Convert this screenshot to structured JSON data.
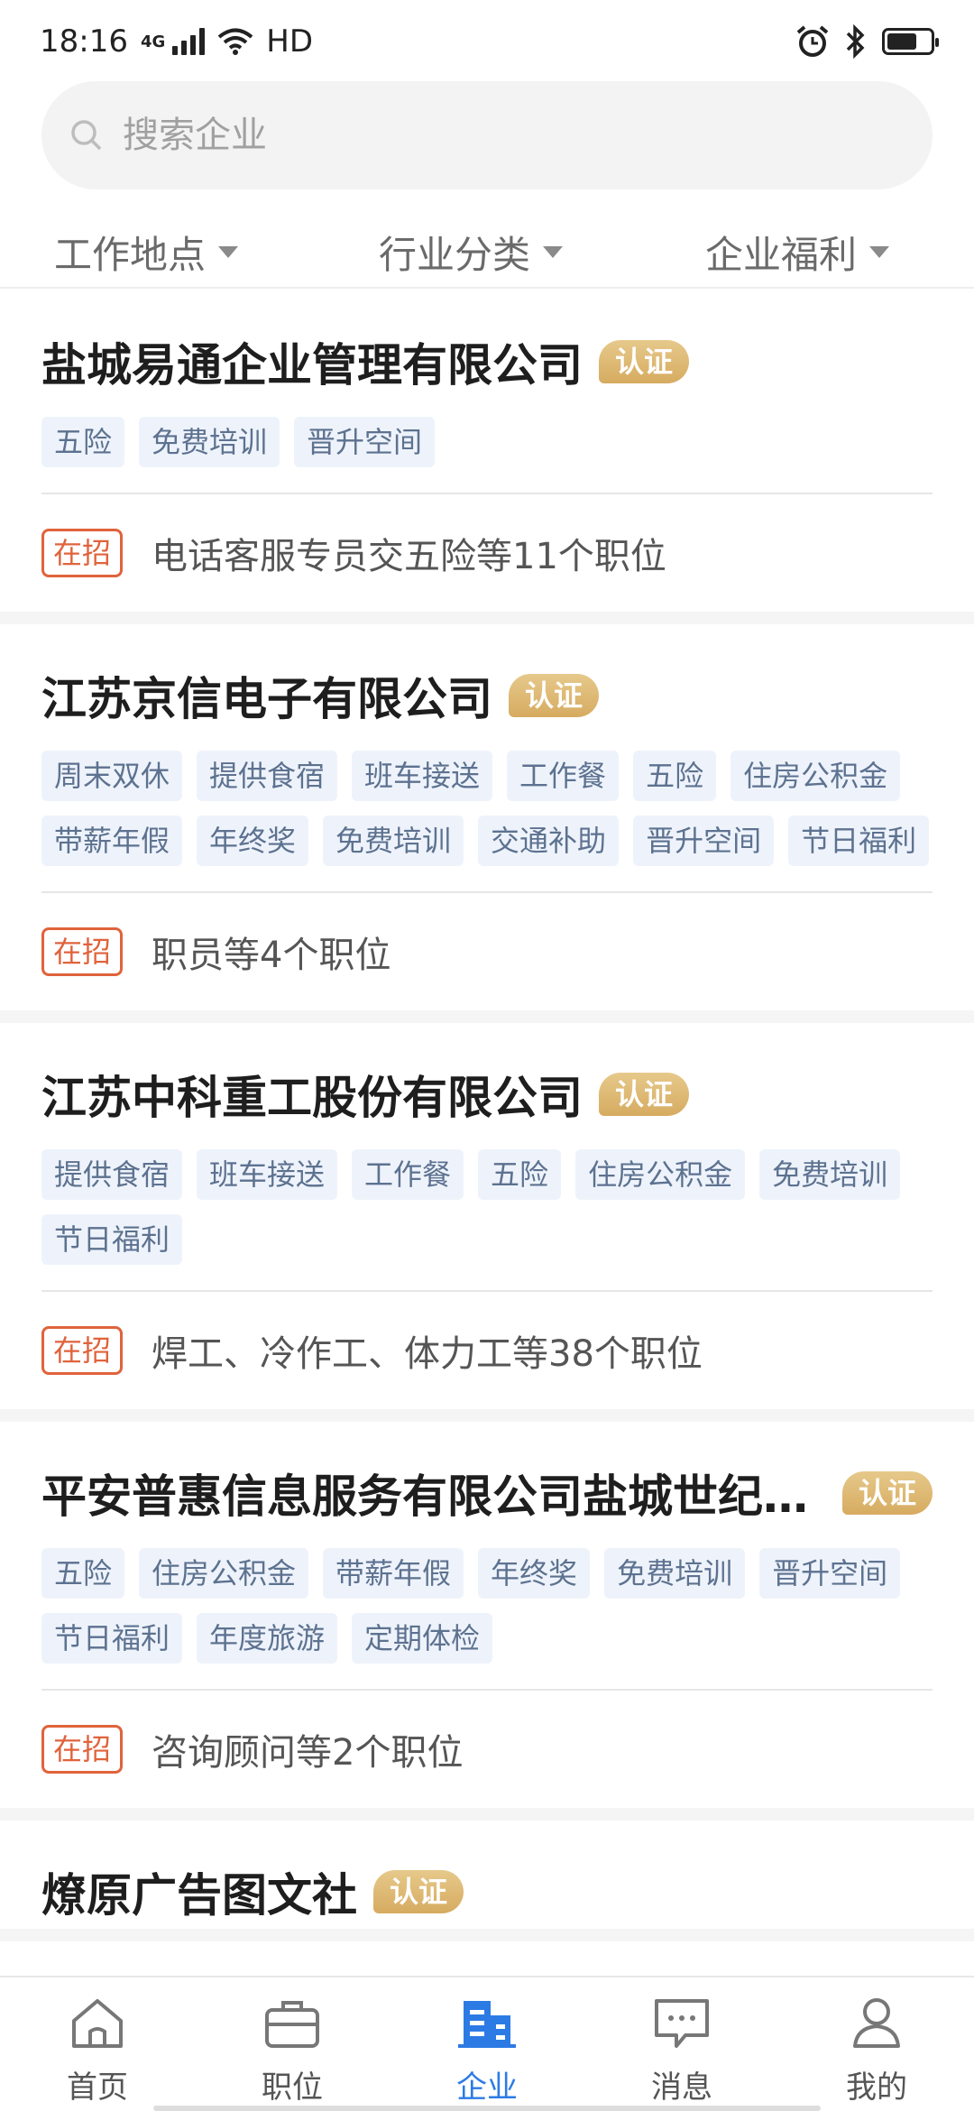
{
  "status_bar": {
    "time": "18:16",
    "network": "4G",
    "hd": "HD"
  },
  "search": {
    "placeholder": "搜索企业"
  },
  "filters": [
    "工作地点",
    "行业分类",
    "企业福利"
  ],
  "companies": [
    {
      "name": "盐城易通企业管理有限公司",
      "badge": "认证",
      "tags": [
        "五险",
        "免费培训",
        "晋升空间"
      ],
      "hiring_label": "在招",
      "positions": "电话客服专员交五险等11个职位"
    },
    {
      "name": "江苏京信电子有限公司",
      "badge": "认证",
      "tags": [
        "周末双休",
        "提供食宿",
        "班车接送",
        "工作餐",
        "五险",
        "住房公积金",
        "带薪年假",
        "年终奖",
        "免费培训",
        "交通补助",
        "晋升空间",
        "节日福利"
      ],
      "hiring_label": "在招",
      "positions": "职员等4个职位"
    },
    {
      "name": "江苏中科重工股份有限公司",
      "badge": "认证",
      "tags": [
        "提供食宿",
        "班车接送",
        "工作餐",
        "五险",
        "住房公积金",
        "免费培训",
        "节日福利"
      ],
      "hiring_label": "在招",
      "positions": "焊工、冷作工、体力工等38个职位"
    },
    {
      "name": "平安普惠信息服务有限公司盐城世纪大...",
      "badge": "认证",
      "tags": [
        "五险",
        "住房公积金",
        "带薪年假",
        "年终奖",
        "免费培训",
        "晋升空间",
        "节日福利",
        "年度旅游",
        "定期体检"
      ],
      "hiring_label": "在招",
      "positions": "咨询顾问等2个职位"
    },
    {
      "name": "燎原广告图文社",
      "badge": "认证",
      "tags": [],
      "hiring_label": "",
      "positions": ""
    }
  ],
  "bottom_nav": [
    {
      "label": "首页",
      "icon": "home-icon",
      "active": false
    },
    {
      "label": "职位",
      "icon": "briefcase-icon",
      "active": false
    },
    {
      "label": "企业",
      "icon": "building-icon",
      "active": true
    },
    {
      "label": "消息",
      "icon": "message-icon",
      "active": false
    },
    {
      "label": "我的",
      "icon": "profile-icon",
      "active": false
    }
  ],
  "colors": {
    "accent": "#2c7be5",
    "badge": "#d6ab60",
    "hiring": "#e0633c",
    "tag_bg": "#eef3fb",
    "tag_text": "#5d7290"
  }
}
